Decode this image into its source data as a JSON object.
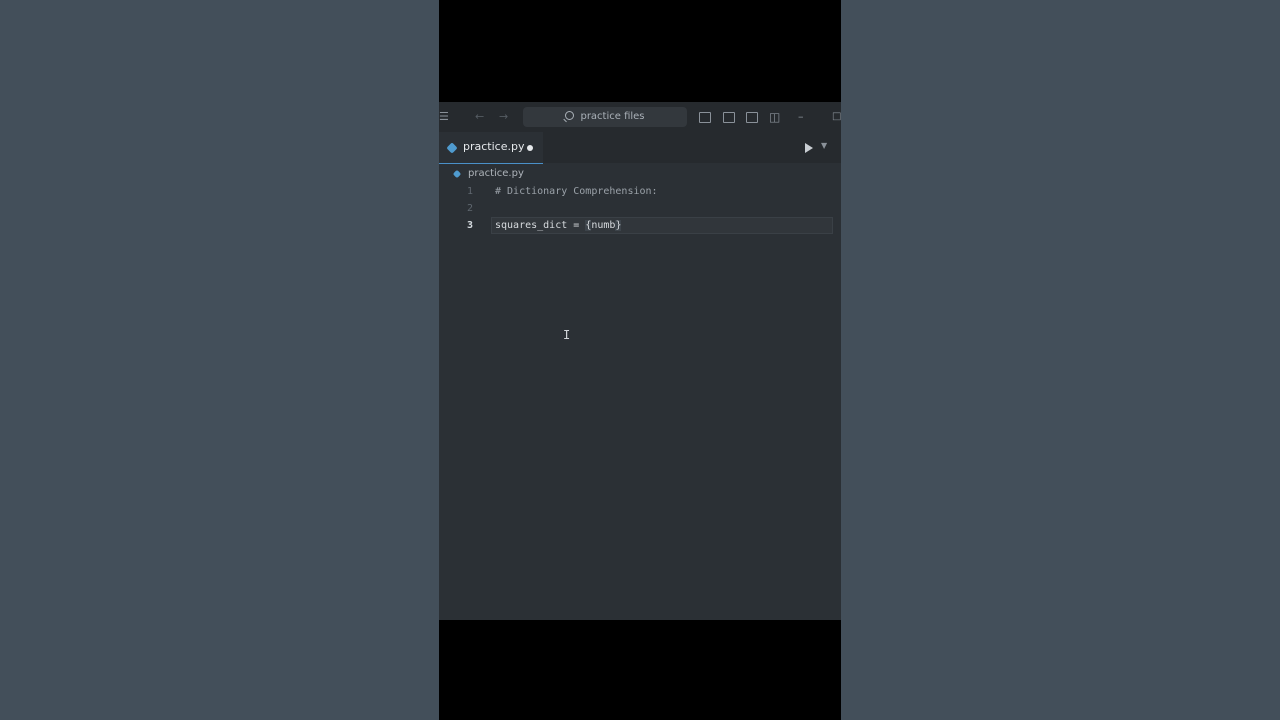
{
  "titlebar": {
    "search_label": "practice files",
    "icons": [
      "menu-icon",
      "back-arrow-icon",
      "forward-arrow-icon",
      "search-icon",
      "toggle-sidebar-icon",
      "toggle-panel-icon",
      "toggle-secondary-sidebar-icon",
      "customize-layout-icon",
      "minimize-icon",
      "maximize-icon"
    ]
  },
  "tab": {
    "label": "practice.py"
  },
  "breadcrumb": {
    "file": "practice.py"
  },
  "code": {
    "lines": [
      {
        "number": "1",
        "text": "# Dictionary Comprehension:"
      },
      {
        "number": "2",
        "text": ""
      },
      {
        "number": "3",
        "var": "squares_dict",
        "op": " = ",
        "brace_open": "{",
        "partial": "numb",
        "brace_close": "}"
      }
    ]
  },
  "colors": {
    "background": "#434f5a",
    "editor_bg": "#2b3035",
    "accent": "#4a90c8"
  }
}
